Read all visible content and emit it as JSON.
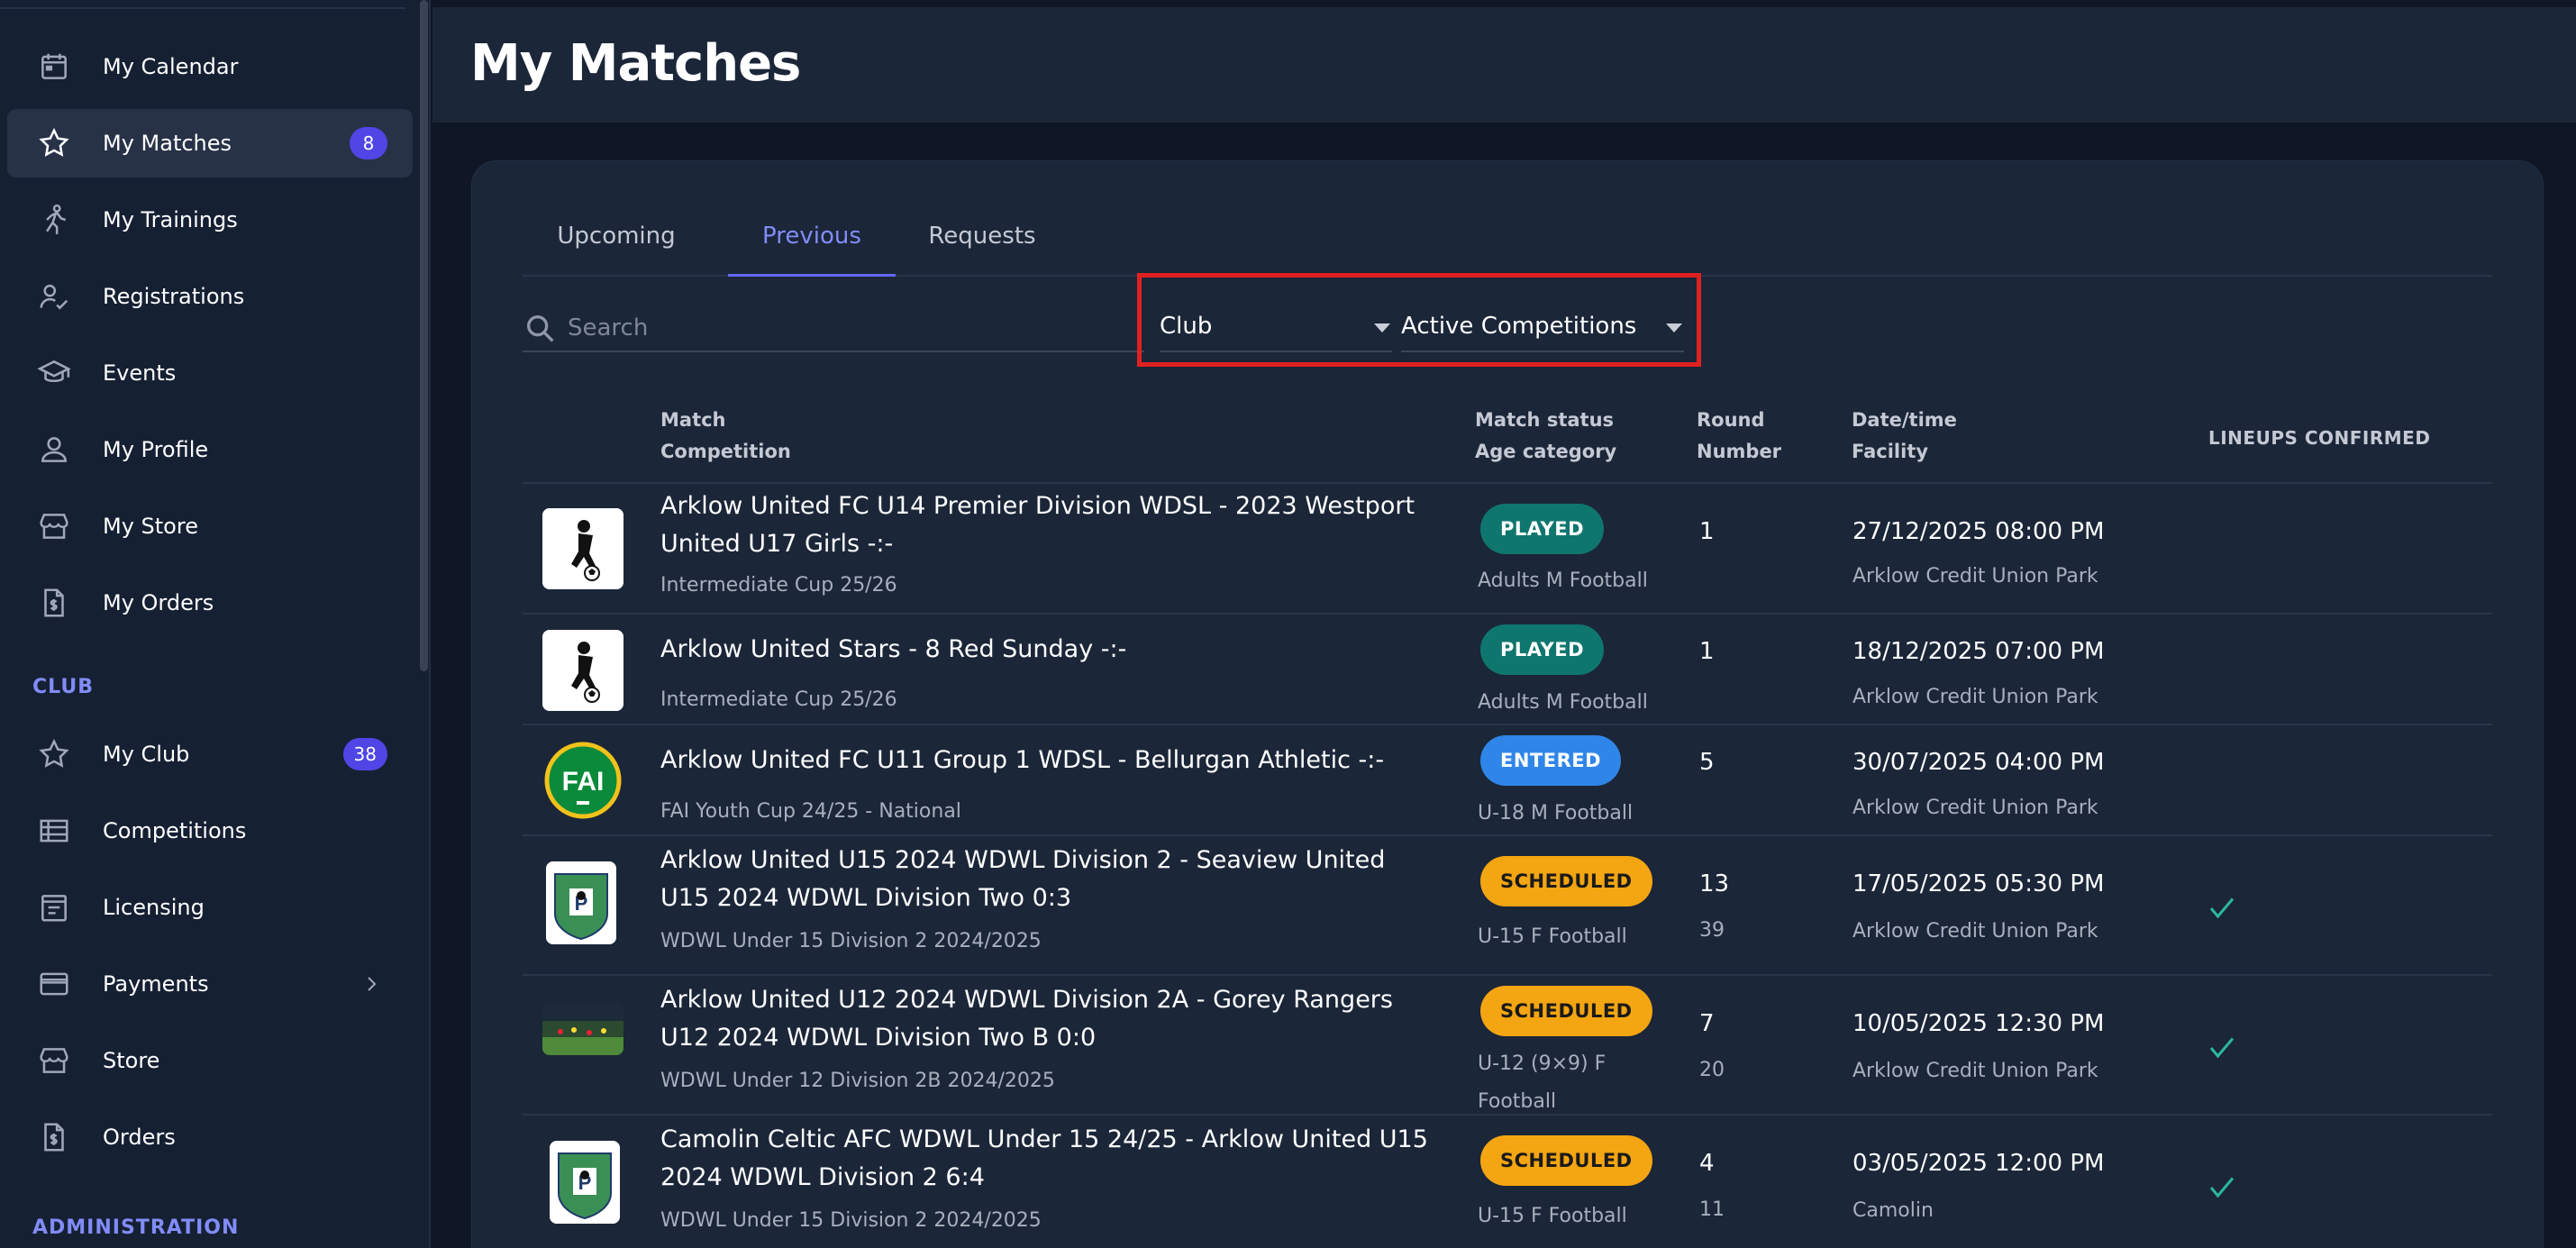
{
  "page": {
    "title": "My Matches"
  },
  "sidebar": {
    "items": [
      {
        "label": "My Calendar",
        "icon": "calendar-icon"
      },
      {
        "label": "My Matches",
        "icon": "star-icon",
        "badge": "8",
        "active": true
      },
      {
        "label": "My Trainings",
        "icon": "running-icon"
      },
      {
        "label": "Registrations",
        "icon": "person-check-icon"
      },
      {
        "label": "Events",
        "icon": "graduation-cap-icon"
      },
      {
        "label": "My Profile",
        "icon": "person-icon"
      },
      {
        "label": "My Store",
        "icon": "store-icon"
      },
      {
        "label": "My Orders",
        "icon": "invoice-icon"
      }
    ],
    "club_section": "CLUB",
    "club_items": [
      {
        "label": "My Club",
        "icon": "star-icon",
        "badge": "38"
      },
      {
        "label": "Competitions",
        "icon": "list-icon"
      },
      {
        "label": "Licensing",
        "icon": "license-icon"
      },
      {
        "label": "Payments",
        "icon": "credit-card-icon"
      },
      {
        "label": "Store",
        "icon": "store-icon"
      },
      {
        "label": "Orders",
        "icon": "invoice-icon"
      }
    ],
    "admin_section": "ADMINISTRATION"
  },
  "tabs": [
    {
      "label": "Upcoming"
    },
    {
      "label": "Previous",
      "active": true
    },
    {
      "label": "Requests"
    }
  ],
  "filters": {
    "search_placeholder": "Search",
    "club_select": "Club",
    "competition_select": "Active Competitions"
  },
  "table": {
    "headers": {
      "match": "Match",
      "competition": "Competition",
      "match_status": "Match status",
      "age_category": "Age category",
      "round": "Round",
      "number": "Number",
      "datetime": "Date/time",
      "facility": "Facility",
      "lineups": "LINEUPS CONFIRMED"
    },
    "rows": [
      {
        "title": "Arklow United FC U14 Premier Division WDSL - 2023 Westport United U17 Girls -:-",
        "competition": "Intermediate Cup 25/26",
        "status": "PLAYED",
        "age": "Adults M Football",
        "round": "1",
        "number": "",
        "datetime": "27/12/2025 08:00 PM",
        "facility": "Arklow Credit Union Park",
        "lineups": false
      },
      {
        "title": "Arklow United Stars - 8 Red Sunday -:-",
        "competition": "Intermediate Cup 25/26",
        "status": "PLAYED",
        "age": "Adults M Football",
        "round": "1",
        "number": "",
        "datetime": "18/12/2025 07:00 PM",
        "facility": "Arklow Credit Union Park",
        "lineups": false
      },
      {
        "title": "Arklow United FC U11 Group 1 WDSL - Bellurgan Athletic -:-",
        "competition": "FAI Youth Cup 24/25 - National",
        "status": "ENTERED",
        "age": "U-18 M Football",
        "round": "5",
        "number": "",
        "datetime": "30/07/2025 04:00 PM",
        "facility": "Arklow Credit Union Park",
        "lineups": false
      },
      {
        "title": "Arklow United U15 2024 WDWL Division 2 - Seaview United U15 2024 WDWL Division Two 0:3",
        "competition": "WDWL Under 15 Division 2 2024/2025",
        "status": "SCHEDULED",
        "age": "U-15 F Football",
        "round": "13",
        "number": "39",
        "datetime": "17/05/2025 05:30 PM",
        "facility": "Arklow Credit Union Park",
        "lineups": true
      },
      {
        "title": "Arklow United U12 2024 WDWL Division 2A - Gorey Rangers U12 2024 WDWL Division Two B 0:0",
        "competition": "WDWL Under 12 Division 2B 2024/2025",
        "status": "SCHEDULED",
        "age": "U-12 (9×9) F Football",
        "round": "7",
        "number": "20",
        "datetime": "10/05/2025 12:30 PM",
        "facility": "Arklow Credit Union Park",
        "lineups": true
      },
      {
        "title": "Camolin Celtic AFC WDWL Under 15 24/25 - Arklow United U15 2024 WDWL Division 2 6:4",
        "competition": "WDWL Under 15 Division 2 2024/2025",
        "status": "SCHEDULED",
        "age": "U-15 F Football",
        "round": "4",
        "number": "11",
        "datetime": "03/05/2025 12:00 PM",
        "facility": "Camolin",
        "lineups": true
      }
    ]
  },
  "logos": {
    "fai_text": "FAI"
  },
  "colors": {
    "accent": "#6366f1",
    "played": "#0f766e",
    "entered": "#2f86e8",
    "scheduled": "#f4a512",
    "highlight": "#e0211f",
    "check": "#2cb89a"
  }
}
